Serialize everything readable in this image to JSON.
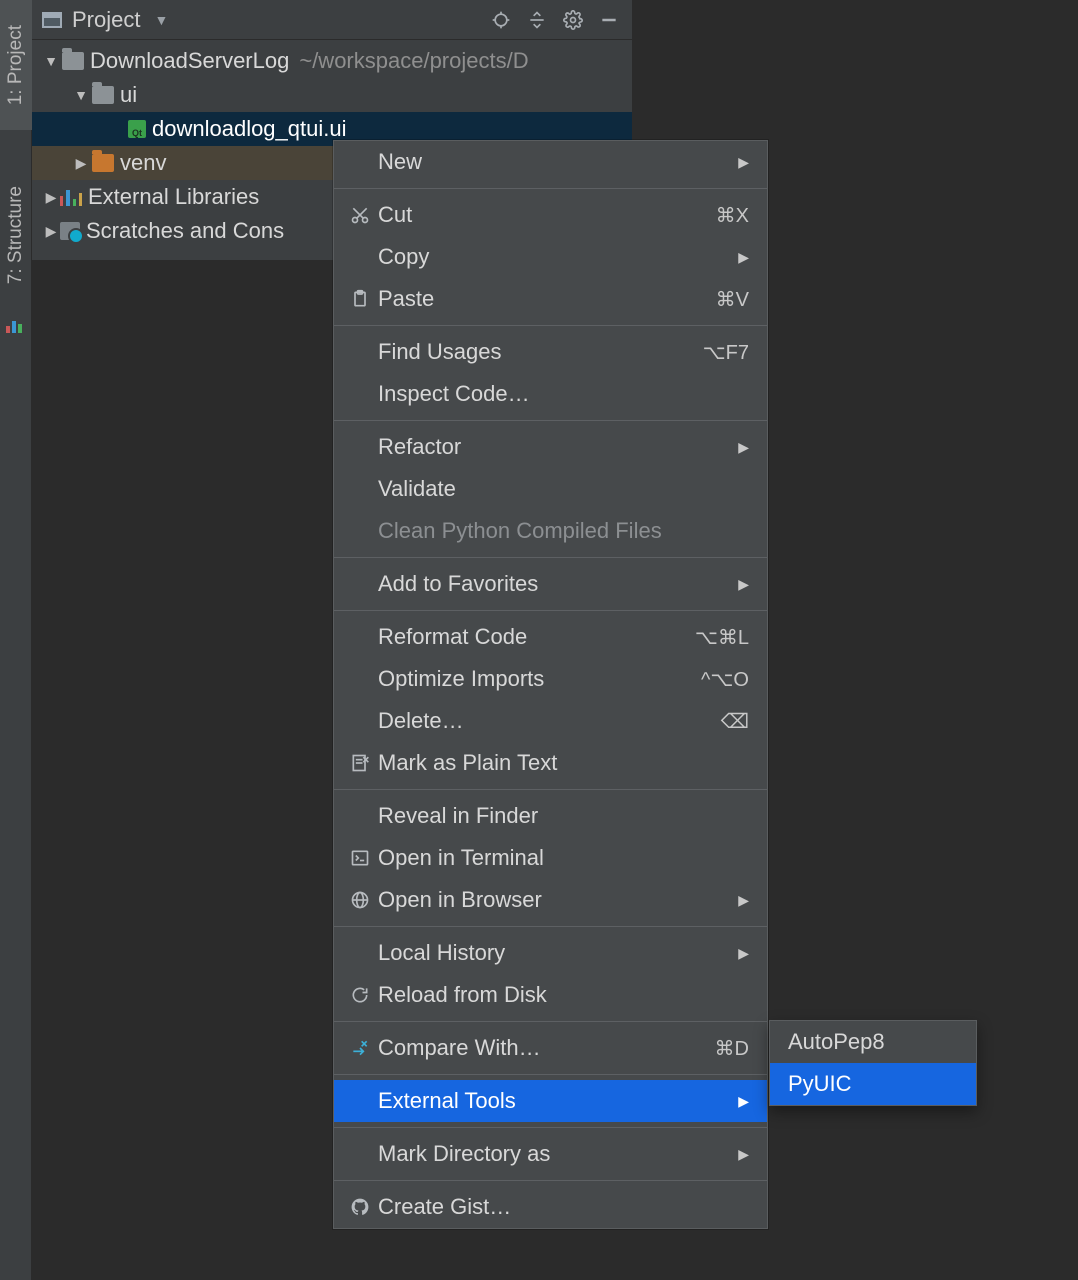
{
  "tabs": {
    "project": "1: Project",
    "structure": "7: Structure"
  },
  "panelHeader": {
    "title": "Project"
  },
  "tree": {
    "root": {
      "name": "DownloadServerLog",
      "path": "~/workspace/projects/D"
    },
    "ui": {
      "name": "ui"
    },
    "file": {
      "name": "downloadlog_qtui.ui",
      "badge": "Qt"
    },
    "venv": {
      "name": "venv"
    },
    "extlib": {
      "name": "External Libraries"
    },
    "scratch": {
      "name": "Scratches and Cons"
    }
  },
  "menu": {
    "new": "New",
    "cut": "Cut",
    "cut_sc": "⌘X",
    "copy": "Copy",
    "paste": "Paste",
    "paste_sc": "⌘V",
    "findUsages": "Find Usages",
    "findUsages_sc": "⌥F7",
    "inspect": "Inspect Code…",
    "refactor": "Refactor",
    "validate": "Validate",
    "cleanPyc": "Clean Python Compiled Files",
    "addFav": "Add to Favorites",
    "reformat": "Reformat Code",
    "reformat_sc": "⌥⌘L",
    "optImports": "Optimize Imports",
    "optImports_sc": "^⌥O",
    "delete": "Delete…",
    "delete_sc": "⌫",
    "markPlain": "Mark as Plain Text",
    "reveal": "Reveal in Finder",
    "openTerm": "Open in Terminal",
    "openBrowser": "Open in Browser",
    "localHist": "Local History",
    "reload": "Reload from Disk",
    "compare": "Compare With…",
    "compare_sc": "⌘D",
    "extTools": "External Tools",
    "markDir": "Mark Directory as",
    "gist": "Create Gist…"
  },
  "submenu": {
    "autopep8": "AutoPep8",
    "pyuic": "PyUIC"
  }
}
